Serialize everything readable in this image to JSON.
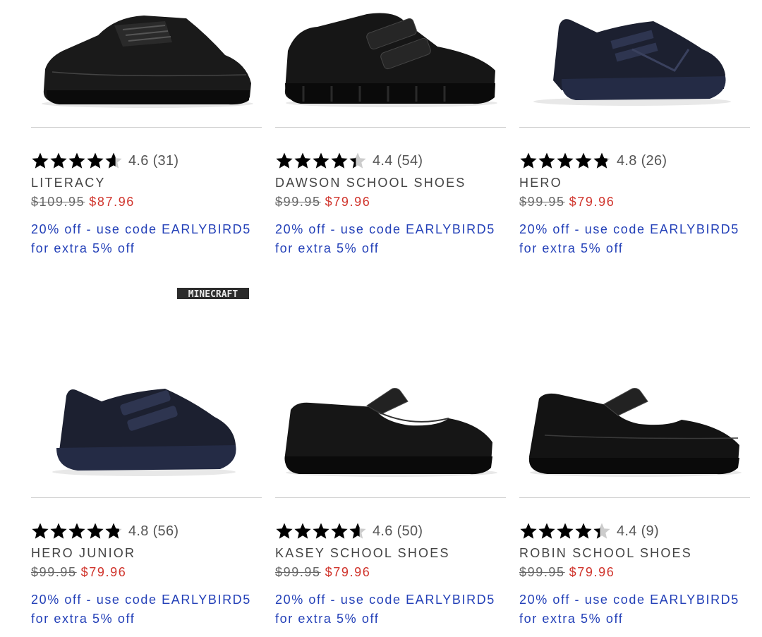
{
  "products": [
    {
      "id": "literacy",
      "rating": 4.6,
      "rating_text": "4.6",
      "reviews": "(31)",
      "name": "LITERACY",
      "old_price": "$109.95",
      "new_price": "$87.96",
      "promo_line1": "20% off - use code EARLYBIRD5",
      "promo_line2": "for extra 5% off",
      "image_icon": "lace-up-school-shoe"
    },
    {
      "id": "dawson",
      "rating": 4.4,
      "rating_text": "4.4",
      "reviews": "(54)",
      "name": "DAWSON SCHOOL SHOES",
      "old_price": "$99.95",
      "new_price": "$79.96",
      "promo_line1": "20% off - use code EARLYBIRD5",
      "promo_line2": "for extra 5% off",
      "image_icon": "velcro-school-shoe"
    },
    {
      "id": "hero",
      "rating": 4.8,
      "rating_text": "4.8",
      "reviews": "(26)",
      "name": "HERO",
      "old_price": "$99.95",
      "new_price": "$79.96",
      "promo_line1": "20% off - use code EARLYBIRD5",
      "promo_line2": "for extra 5% off",
      "image_icon": "sneaker-school-shoe"
    },
    {
      "id": "hero-junior",
      "rating": 4.8,
      "rating_text": "4.8",
      "reviews": "(56)",
      "name": "HERO JUNIOR",
      "old_price": "$99.95",
      "new_price": "$79.96",
      "promo_line1": "20% off - use code EARLYBIRD5",
      "promo_line2": "for extra 5% off",
      "image_icon": "velcro-sneaker-school-shoe"
    },
    {
      "id": "kasey",
      "rating": 4.6,
      "rating_text": "4.6",
      "reviews": "(50)",
      "name": "KASEY SCHOOL SHOES",
      "old_price": "$99.95",
      "new_price": "$79.96",
      "promo_line1": "20% off - use code EARLYBIRD5",
      "promo_line2": "for extra 5% off",
      "image_icon": "mary-jane-school-shoe"
    },
    {
      "id": "robin",
      "rating": 4.4,
      "rating_text": "4.4",
      "reviews": "(9)",
      "name": "ROBIN SCHOOL SHOES",
      "old_price": "$99.95",
      "new_price": "$79.96",
      "promo_line1": "20% off - use code EARLYBIRD5",
      "promo_line2": "for extra 5% off",
      "image_icon": "mary-jane-school-shoe"
    }
  ],
  "badge": {
    "label": "MINECRAFT"
  },
  "colors": {
    "price_sale": "#d0342c",
    "promo": "#2340b8",
    "star": "#000000",
    "star_empty": "#cccccc"
  }
}
